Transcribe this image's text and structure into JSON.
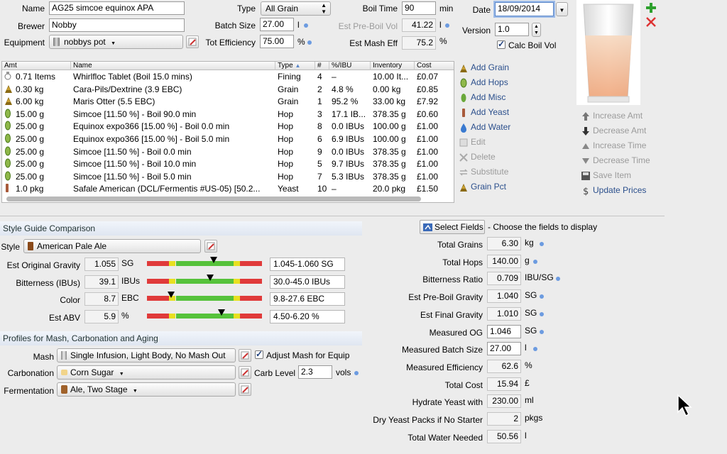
{
  "header": {
    "name_label": "Name",
    "name_value": "AG25 simcoe equinox  APA",
    "type_label": "Type",
    "type_value": "All Grain",
    "boil_time_label": "Boil Time",
    "boil_time_value": "90",
    "boil_time_unit": "min",
    "date_label": "Date",
    "date_value": "18/09/2014",
    "brewer_label": "Brewer",
    "brewer_value": "Nobby",
    "batch_size_label": "Batch Size",
    "batch_size_value": "27.00",
    "batch_size_unit": "l",
    "pre_boil_label": "Est Pre-Boil Vol",
    "pre_boil_value": "41.22",
    "pre_boil_unit": "l",
    "version_label": "Version",
    "version_value": "1.0",
    "equipment_label": "Equipment",
    "equipment_value": "nobbys pot",
    "efficiency_label": "Tot Efficiency",
    "efficiency_value": "75.00",
    "efficiency_unit": "%",
    "mash_eff_label": "Est Mash Eff",
    "mash_eff_value": "75.2",
    "mash_eff_unit": "%",
    "calc_boil_label": "Calc Boil Vol"
  },
  "table": {
    "columns": [
      "Amt",
      "Name",
      "Type",
      "#",
      "%/IBU",
      "Inventory",
      "Cost"
    ],
    "rows": [
      {
        "amt": "0.71 Items",
        "name": "Whirlfloc Tablet (Boil 15.0 mins)",
        "type": "Fining",
        "num": "4",
        "pct": "–",
        "inv": "10.00 It...",
        "cost": "£0.07",
        "icon": "misc"
      },
      {
        "amt": "0.30 kg",
        "name": "Cara-Pils/Dextrine (3.9 EBC)",
        "type": "Grain",
        "num": "2",
        "pct": "4.8 %",
        "inv": "0.00 kg",
        "cost": "£0.85",
        "icon": "grain"
      },
      {
        "amt": "6.00 kg",
        "name": "Maris Otter (5.5 EBC)",
        "type": "Grain",
        "num": "1",
        "pct": "95.2 %",
        "inv": "33.00 kg",
        "cost": "£7.92",
        "icon": "grain"
      },
      {
        "amt": "15.00 g",
        "name": "Simcoe [11.50 %] - Boil 90.0 min",
        "type": "Hop",
        "num": "3",
        "pct": "17.1 IB...",
        "inv": "378.35 g",
        "cost": "£0.60",
        "icon": "hop"
      },
      {
        "amt": "25.00 g",
        "name": "Equinox expo366 [15.00 %] - Boil 0.0 min",
        "type": "Hop",
        "num": "8",
        "pct": "0.0 IBUs",
        "inv": "100.00 g",
        "cost": "£1.00",
        "icon": "hop"
      },
      {
        "amt": "25.00 g",
        "name": "Equinox expo366 [15.00 %] - Boil 5.0 min",
        "type": "Hop",
        "num": "6",
        "pct": "6.9 IBUs",
        "inv": "100.00 g",
        "cost": "£1.00",
        "icon": "hop"
      },
      {
        "amt": "25.00 g",
        "name": "Simcoe [11.50 %] - Boil 0.0 min",
        "type": "Hop",
        "num": "9",
        "pct": "0.0 IBUs",
        "inv": "378.35 g",
        "cost": "£1.00",
        "icon": "hop"
      },
      {
        "amt": "25.00 g",
        "name": "Simcoe [11.50 %] - Boil 10.0 min",
        "type": "Hop",
        "num": "5",
        "pct": "9.7 IBUs",
        "inv": "378.35 g",
        "cost": "£1.00",
        "icon": "hop"
      },
      {
        "amt": "25.00 g",
        "name": "Simcoe [11.50 %] - Boil 5.0 min",
        "type": "Hop",
        "num": "7",
        "pct": "5.3 IBUs",
        "inv": "378.35 g",
        "cost": "£1.00",
        "icon": "hop"
      },
      {
        "amt": "1.0 pkg",
        "name": "Safale American  (DCL/Fermentis #US-05) [50.2...",
        "type": "Yeast",
        "num": "10",
        "pct": "–",
        "inv": "20.0 pkg",
        "cost": "£1.50",
        "icon": "yeast"
      }
    ]
  },
  "actions": {
    "add_grain": "Add Grain",
    "add_hops": "Add Hops",
    "add_misc": "Add Misc",
    "add_yeast": "Add Yeast",
    "add_water": "Add Water",
    "edit": "Edit",
    "delete": "Delete",
    "substitute": "Substitute",
    "grain_pct": "Grain Pct",
    "increase_amt": "Increase Amt",
    "decrease_amt": "Decrease Amt",
    "increase_time": "Increase Time",
    "decrease_time": "Decrease Time",
    "save_item": "Save Item",
    "update_prices": "Update Prices"
  },
  "style": {
    "section_title": "Style Guide Comparison",
    "style_label": "Style",
    "style_value": "American Pale Ale",
    "rows": [
      {
        "label": "Est Original Gravity",
        "value": "1.055",
        "unit": "SG",
        "range": "1.045-1.060 SG",
        "marker": 0.58
      },
      {
        "label": "Bitterness (IBUs)",
        "value": "39.1",
        "unit": "IBUs",
        "range": "30.0-45.0 IBUs",
        "marker": 0.55
      },
      {
        "label": "Color",
        "value": "8.7",
        "unit": "EBC",
        "range": "9.8-27.6 EBC",
        "marker": 0.21
      },
      {
        "label": "Est ABV",
        "value": "5.9",
        "unit": "%",
        "range": "4.50-6.20 %",
        "marker": 0.65
      }
    ]
  },
  "profiles": {
    "section_title": "Profiles for Mash, Carbonation and Aging",
    "mash_label": "Mash",
    "mash_value": "Single Infusion, Light Body, No Mash Out",
    "adjust_mash_label": "Adjust Mash for Equip",
    "carb_label": "Carbonation",
    "carb_value": "Corn Sugar",
    "carb_level_label": "Carb Level",
    "carb_level_value": "2.3",
    "carb_level_unit": "vols",
    "ferm_label": "Fermentation",
    "ferm_value": "Ale, Two Stage"
  },
  "fields": {
    "select_button": "Select Fields",
    "hint": "- Choose the fields to display",
    "rows": [
      {
        "label": "Total Grains",
        "value": "6.30",
        "unit": "kg",
        "dot": true,
        "editable": false
      },
      {
        "label": "Total Hops",
        "value": "140.00",
        "unit": "g",
        "dot": true,
        "editable": false
      },
      {
        "label": "Bitterness Ratio",
        "value": "0.709",
        "unit": "IBU/SG",
        "dot": true,
        "editable": false
      },
      {
        "label": "Est Pre-Boil Gravity",
        "value": "1.040",
        "unit": "SG",
        "dot": true,
        "editable": false
      },
      {
        "label": "Est Final Gravity",
        "value": "1.010",
        "unit": "SG",
        "dot": true,
        "editable": false
      },
      {
        "label": "Measured OG",
        "value": "1.046",
        "unit": "SG",
        "dot": true,
        "editable": true
      },
      {
        "label": "Measured Batch Size",
        "value": "27.00",
        "unit": "l",
        "dot": true,
        "editable": true
      },
      {
        "label": "Measured Efficiency",
        "value": "62.6",
        "unit": "%",
        "dot": false,
        "editable": false
      },
      {
        "label": "Total Cost",
        "value": "15.94",
        "unit": "£",
        "dot": false,
        "editable": false
      },
      {
        "label": "Hydrate Yeast with",
        "value": "230.00",
        "unit": "ml",
        "dot": false,
        "editable": false
      },
      {
        "label": "Dry Yeast Packs if No Starter",
        "value": "2",
        "unit": "pkgs",
        "dot": false,
        "editable": false
      },
      {
        "label": "Total Water Needed",
        "value": "50.56",
        "unit": "l",
        "dot": false,
        "editable": false
      }
    ]
  },
  "colors": {
    "accent": "#2b4f8c",
    "meter_red": "#e03a3a",
    "meter_yellow": "#e8e020",
    "meter_green": "#56c23b"
  }
}
